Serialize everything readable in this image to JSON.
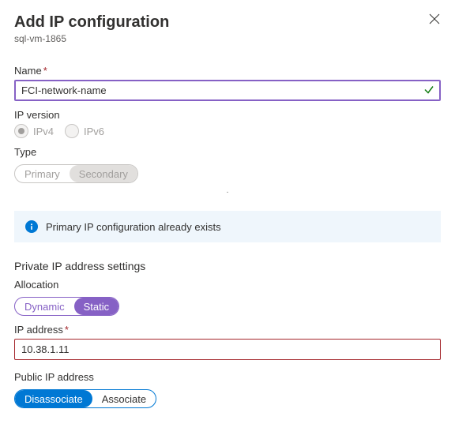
{
  "header": {
    "title": "Add IP configuration",
    "subtitle": "sql-vm-1865"
  },
  "name": {
    "label": "Name",
    "value": "FCI-network-name"
  },
  "ipVersion": {
    "label": "IP version",
    "options": {
      "ipv4": "IPv4",
      "ipv6": "IPv6"
    },
    "selected": "IPv4"
  },
  "type": {
    "label": "Type",
    "options": {
      "primary": "Primary",
      "secondary": "Secondary"
    },
    "selected": "Secondary"
  },
  "info": {
    "message": "Primary IP configuration already exists"
  },
  "privateSection": {
    "title": "Private IP address settings",
    "allocation": {
      "label": "Allocation",
      "options": {
        "dynamic": "Dynamic",
        "static": "Static"
      },
      "selected": "Static"
    },
    "ipAddress": {
      "label": "IP address",
      "value": "10.38.1.11"
    }
  },
  "publicIp": {
    "label": "Public IP address",
    "options": {
      "disassociate": "Disassociate",
      "associate": "Associate"
    },
    "selected": "Disassociate"
  }
}
